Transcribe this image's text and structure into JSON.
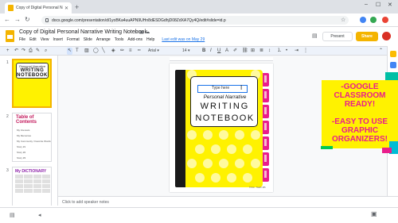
{
  "browser": {
    "tab_title": "Copy of Digital Personal Narrati...",
    "tab_close": "✕",
    "new_tab": "+",
    "url": "docs.google.com/presentation/d/1yoBKa4uuAPN9UHn8dESDGdhjD08ZdXA7Qy4Q/edit#slide=id.p",
    "window_controls": [
      "–",
      "☐",
      "✕"
    ]
  },
  "header": {
    "title": "Copy of Digital Personal Narrative Writing Notebook",
    "menu": [
      "File",
      "Edit",
      "View",
      "Insert",
      "Format",
      "Slide",
      "Arrange",
      "Tools",
      "Add-ons",
      "Help"
    ],
    "last_edit": "Last edit was on May 29",
    "present_label": "Present",
    "share_label": "Share"
  },
  "toolbar": {
    "font": "Arial",
    "size": "14"
  },
  "slides": [
    {
      "number": "1",
      "small": "Personal Narrative",
      "line1": "WRITING",
      "line2": "NOTEBOOK"
    },
    {
      "number": "2",
      "heading": "Table of Contents",
      "items": [
        "My Interests",
        "My Memories",
        "My Community / Favorite Words",
        "Story #1",
        "Story #2",
        "Story #3"
      ]
    },
    {
      "number": "3",
      "heading": "My DICTIONARY"
    }
  ],
  "main_slide": {
    "type_here": "Type here",
    "small_title": "Personal Narrative",
    "line1": "WRITING",
    "line2": "NOTEBOOK",
    "credit": "© Kim · Teach 365"
  },
  "notes": {
    "placeholder": "Click to add speaker notes"
  },
  "promo": {
    "lines": [
      "-GOOGLE",
      "CLASSROOM",
      "READY!",
      "",
      "-EASY TO USE",
      "GRAPHIC",
      "ORGANIZERS!"
    ],
    "text_color": "#e91e8c",
    "bg_color": "#fff200"
  },
  "colors": {
    "accent": "#f4b400",
    "cover_yellow": "#fff200",
    "tab_pink": "#e91e8c"
  }
}
